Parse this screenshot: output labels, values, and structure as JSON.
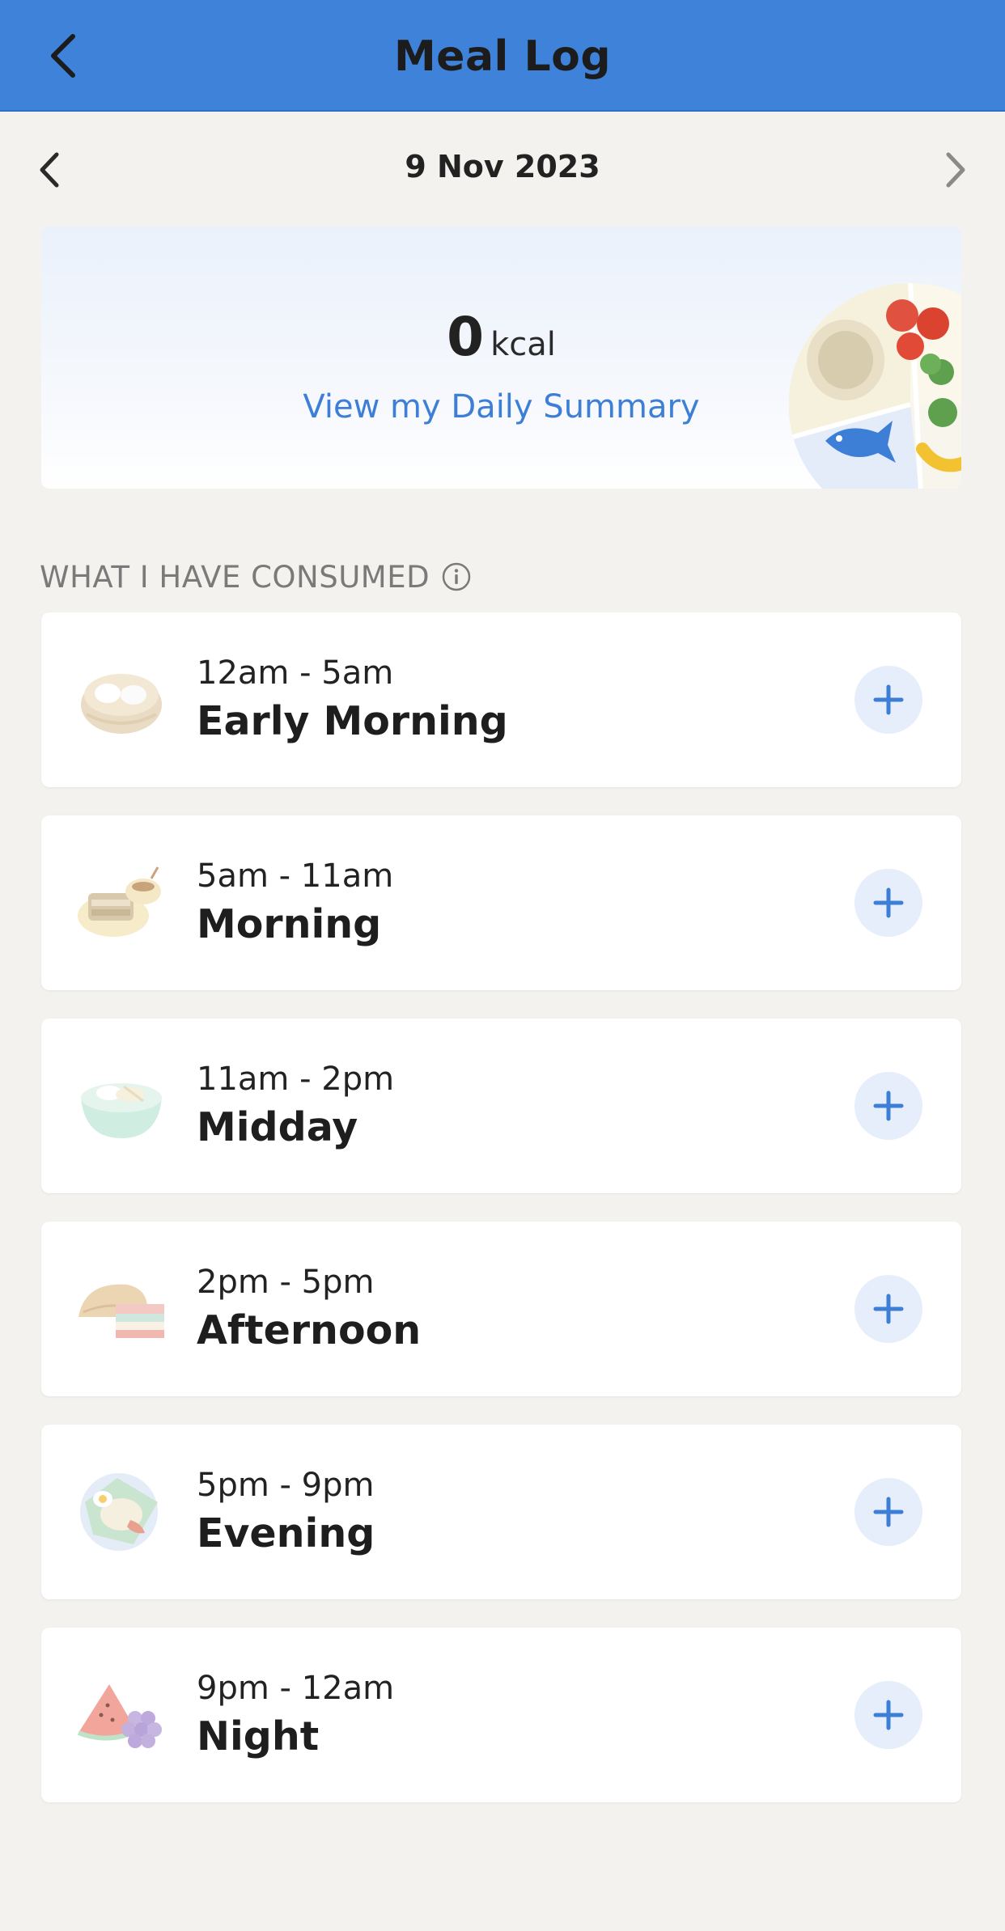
{
  "header": {
    "title": "Meal Log",
    "back_icon": "chevron-left-icon"
  },
  "date_nav": {
    "date": "9 Nov 2023",
    "prev_icon": "chevron-left-icon",
    "next_icon": "chevron-right-icon"
  },
  "summary": {
    "kcal_value": "0",
    "kcal_unit": "kcal",
    "link": "View my Daily Summary",
    "illustration": "food-plate-illustration"
  },
  "consumed": {
    "title": "WHAT I HAVE CONSUMED",
    "info_icon": "info-icon"
  },
  "meals": [
    {
      "time": "12am - 5am",
      "name": "Early Morning",
      "icon": "dim-sum-basket-icon"
    },
    {
      "time": "5am - 11am",
      "name": "Morning",
      "icon": "toast-and-coffee-icon"
    },
    {
      "time": "11am - 2pm",
      "name": "Midday",
      "icon": "noodle-bowl-icon"
    },
    {
      "time": "2pm - 5pm",
      "name": "Afternoon",
      "icon": "curry-puff-and-kueh-icon"
    },
    {
      "time": "5pm - 9pm",
      "name": "Evening",
      "icon": "nasi-lemak-icon"
    },
    {
      "time": "9pm - 12am",
      "name": "Night",
      "icon": "watermelon-and-grapes-icon"
    }
  ],
  "colors": {
    "accent": "#3f82d9",
    "link": "#3d7fd6",
    "add_bg": "#e5eefa",
    "background": "#f3f2ef"
  }
}
